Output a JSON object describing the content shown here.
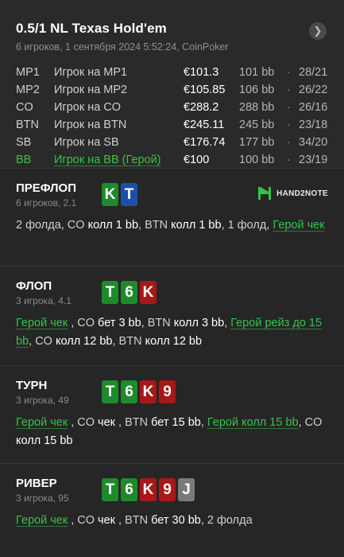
{
  "header": {
    "title": "0.5/1 NL Texas Hold'em",
    "subtitle": "6 игроков, 1 сентября 2024 5:52:24, CoinPoker",
    "next_icon": "chevron-right-icon"
  },
  "players": [
    {
      "pos": "MP1",
      "name": "Игрок на MP1",
      "stack": "€101.3",
      "bb": "101 bb",
      "sep": "·",
      "stat": "28/21",
      "hero": false
    },
    {
      "pos": "MP2",
      "name": "Игрок на MP2",
      "stack": "€105.85",
      "bb": "106 bb",
      "sep": "·",
      "stat": "26/22",
      "hero": false
    },
    {
      "pos": "CO",
      "name": "Игрок на CO",
      "stack": "€288.2",
      "bb": "288 bb",
      "sep": "·",
      "stat": "26/16",
      "hero": false
    },
    {
      "pos": "BTN",
      "name": "Игрок на BTN",
      "stack": "€245.11",
      "bb": "245 bb",
      "sep": "·",
      "stat": "23/18",
      "hero": false
    },
    {
      "pos": "SB",
      "name": "Игрок на SB",
      "stack": "€176.74",
      "bb": "177 bb",
      "sep": "·",
      "stat": "34/20",
      "hero": false
    },
    {
      "pos": "BB",
      "name": "Игрок на BB (Герой)",
      "stack": "€100",
      "bb": "100 bb",
      "sep": "·",
      "stat": "23/19",
      "hero": true
    }
  ],
  "preflop": {
    "name": "ПРЕФЛОП",
    "sub": "6 игроков, 2.1",
    "cards": [
      {
        "rank": "K",
        "suit": "d"
      },
      {
        "rank": "T",
        "suit": "s"
      }
    ],
    "logo_text": "HAND2NOTE",
    "action": [
      {
        "t": "2 фолда, CO ",
        "k": "n"
      },
      {
        "t": "колл 1 bb",
        "k": "w"
      },
      {
        "t": ", BTN ",
        "k": "n"
      },
      {
        "t": "колл 1 bb",
        "k": "w"
      },
      {
        "t": ", 1 фолд, ",
        "k": "n"
      },
      {
        "t": "Герой чек",
        "k": "h"
      }
    ]
  },
  "flop": {
    "name": "ФЛОП",
    "sub": "3 игрока, 4.1",
    "cards": [
      {
        "rank": "T",
        "suit": "d"
      },
      {
        "rank": "6",
        "suit": "d"
      },
      {
        "rank": "K",
        "suit": "h"
      }
    ],
    "action": [
      {
        "t": "Герой чек",
        "k": "h"
      },
      {
        "t": " , CO ",
        "k": "n"
      },
      {
        "t": "бет 3 bb",
        "k": "w"
      },
      {
        "t": ", BTN ",
        "k": "n"
      },
      {
        "t": "колл 3 bb",
        "k": "w"
      },
      {
        "t": ", ",
        "k": "n"
      },
      {
        "t": "Герой рейз до 15 bb",
        "k": "h"
      },
      {
        "t": ", CO ",
        "k": "n"
      },
      {
        "t": "колл 12 bb",
        "k": "w"
      },
      {
        "t": ", BTN ",
        "k": "n"
      },
      {
        "t": "колл 12 bb",
        "k": "w"
      }
    ]
  },
  "turn": {
    "name": "ТУРН",
    "sub": "3 игрока, 49",
    "cards": [
      {
        "rank": "T",
        "suit": "d"
      },
      {
        "rank": "6",
        "suit": "d"
      },
      {
        "rank": "K",
        "suit": "h"
      },
      {
        "rank": "9",
        "suit": "h"
      }
    ],
    "action": [
      {
        "t": "Герой чек",
        "k": "h"
      },
      {
        "t": " , CO ",
        "k": "n"
      },
      {
        "t": "чек",
        "k": "w"
      },
      {
        "t": " , BTN ",
        "k": "n"
      },
      {
        "t": "бет 15 bb",
        "k": "w"
      },
      {
        "t": ", ",
        "k": "n"
      },
      {
        "t": "Герой колл 15 bb",
        "k": "h"
      },
      {
        "t": ", CO ",
        "k": "n"
      },
      {
        "t": "колл 15 bb",
        "k": "w"
      }
    ]
  },
  "river": {
    "name": "РИВЕР",
    "sub": "3 игрока, 95",
    "cards": [
      {
        "rank": "T",
        "suit": "d"
      },
      {
        "rank": "6",
        "suit": "d"
      },
      {
        "rank": "K",
        "suit": "h"
      },
      {
        "rank": "9",
        "suit": "h"
      },
      {
        "rank": "J",
        "suit": "x"
      }
    ],
    "action": [
      {
        "t": "Герой чек",
        "k": "h"
      },
      {
        "t": " , CO ",
        "k": "n"
      },
      {
        "t": "чек",
        "k": "w"
      },
      {
        "t": " , BTN ",
        "k": "n"
      },
      {
        "t": "бет 30 bb",
        "k": "w"
      },
      {
        "t": ", 2 фолда",
        "k": "n"
      }
    ]
  },
  "colors": {
    "hero": "#35c24a",
    "diamonds": "#1f8a2b",
    "hearts": "#a81818",
    "spades": "#1e4fa8",
    "unknown": "#7a7a7a"
  }
}
